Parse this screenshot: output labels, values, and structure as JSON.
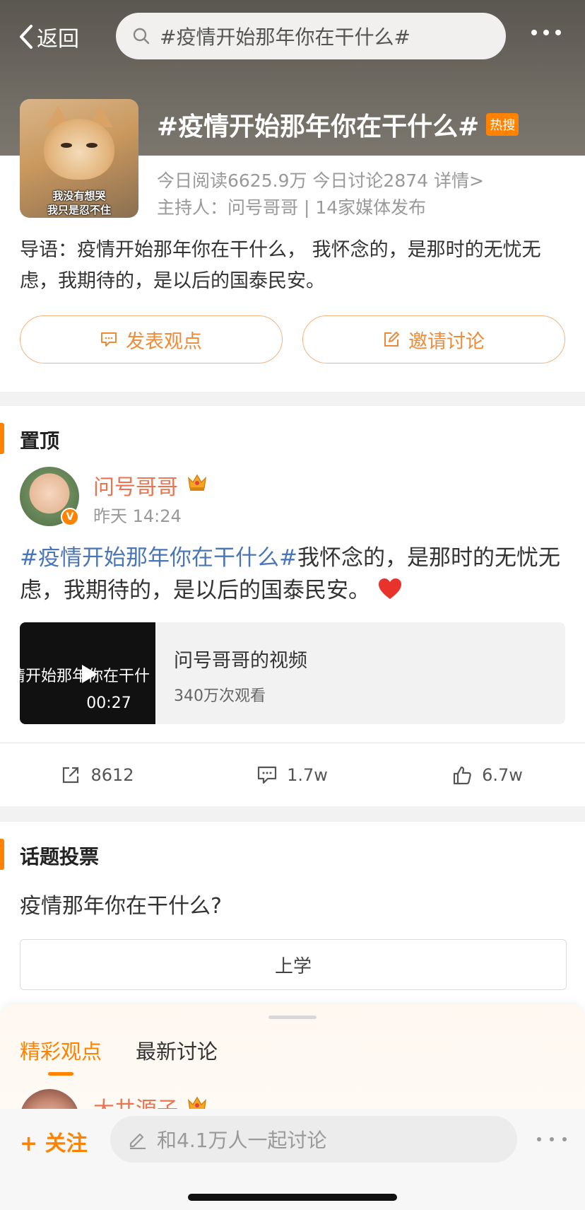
{
  "nav": {
    "back_label": "返回",
    "search_text": "#疫情开始那年你在干什么#"
  },
  "topic": {
    "title": "#疫情开始那年你在干什么#",
    "hot_badge": "热搜",
    "image_caption_line1": "我没有想哭",
    "image_caption_line2": "我只是忍不住",
    "stats_line": "今日阅读6625.9万 今日讨论2874 详情>",
    "host_line": "主持人：问号哥哥 | 14家媒体发布",
    "intro": "导语：疫情开始那年你在干什么， 我怀念的，是那时的无忧无虑，我期待的，是以后的国泰民安。",
    "btn_post": "发表观点",
    "btn_invite": "邀请讨论"
  },
  "pinned": {
    "section_title": "置顶",
    "user_name": "问号哥哥",
    "verified_mark": "V",
    "time": "昨天 14:24",
    "text_tag": "#疫情开始那年你在干什么#",
    "text_body": "我怀念的，是那时的无忧无虑，我期待的，是以后的国泰民安。",
    "video": {
      "thumb_text": "情开始那年你在干什",
      "duration": "00:27",
      "title": "问号哥哥的视频",
      "views": "340万次观看"
    },
    "actions": {
      "repost": "8612",
      "comment": "1.7w",
      "like": "6.7w"
    }
  },
  "vote": {
    "section_title": "话题投票",
    "question": "疫情那年你在干什么?",
    "option_1": "上学"
  },
  "sheet": {
    "tab_featured": "精彩观点",
    "tab_latest": "最新讨论",
    "peek_user": "大井源子"
  },
  "bottom": {
    "follow": "+ 关注",
    "comment_placeholder": "和4.1万人一起讨论"
  },
  "colors": {
    "accent": "#ff8200",
    "username": "#eb7350",
    "topic_link": "#4a76b8"
  }
}
